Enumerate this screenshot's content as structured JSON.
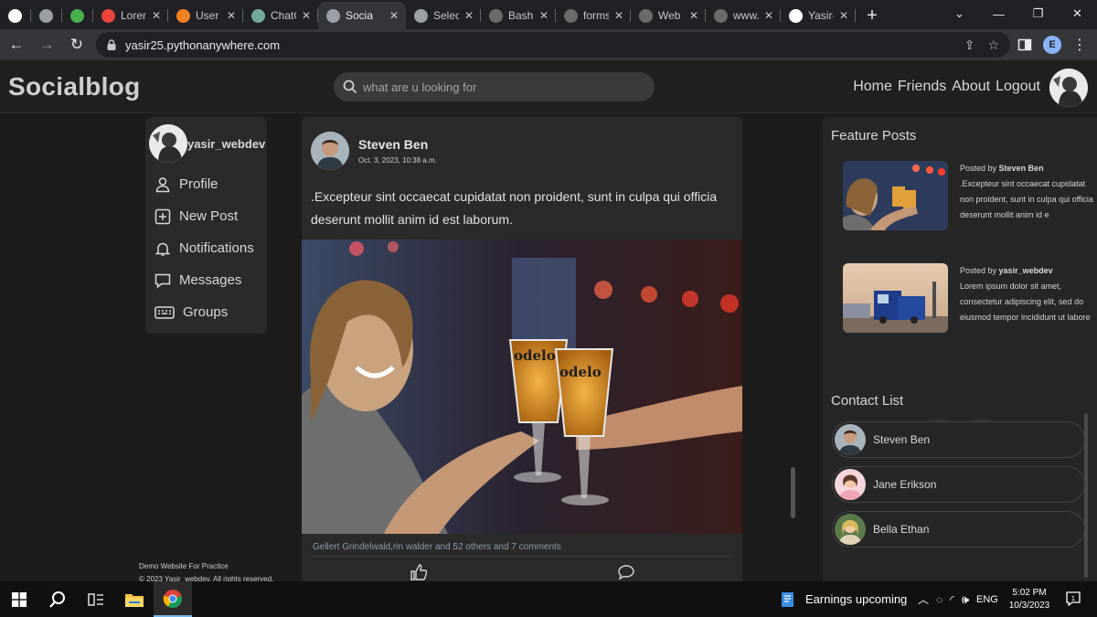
{
  "browser": {
    "tabs": [
      {
        "title": "",
        "favicon": "google-icon",
        "color": "#ffffff"
      },
      {
        "title": "",
        "favicon": "globe-icon",
        "color": "#9aa0a6"
      },
      {
        "title": "",
        "favicon": "colorful-icon",
        "color": "#4caf50"
      },
      {
        "title": "Loren",
        "favicon": "pin-icon",
        "color": "#e8453c"
      },
      {
        "title": "User",
        "favicon": "stack-icon",
        "color": "#f48024"
      },
      {
        "title": "ChatG",
        "favicon": "openai-icon",
        "color": "#74aa9c"
      },
      {
        "title": "Socia",
        "favicon": "globe-icon",
        "color": "#9aa0a6",
        "active": true
      },
      {
        "title": "Selec",
        "favicon": "globe-icon",
        "color": "#9aa0a6"
      },
      {
        "title": "Bash",
        "favicon": "python-icon",
        "color": "#6b6b6b"
      },
      {
        "title": "forms",
        "favicon": "python-icon",
        "color": "#6b6b6b"
      },
      {
        "title": "Web",
        "favicon": "python-icon",
        "color": "#6b6b6b"
      },
      {
        "title": "www.",
        "favicon": "python-icon",
        "color": "#6b6b6b"
      },
      {
        "title": "Yasir-",
        "favicon": "github-icon",
        "color": "#ffffff"
      }
    ],
    "url": "yasir25.pythonanywhere.com",
    "profile_initial": "E"
  },
  "site": {
    "brand": "Socialblog",
    "search_placeholder": "what are u looking for",
    "nav": [
      "Home",
      "Friends",
      "About",
      "Logout"
    ]
  },
  "sidebar": {
    "username": "yasir_webdev",
    "items": [
      {
        "label": "Profile",
        "icon": "user-icon"
      },
      {
        "label": "New Post",
        "icon": "plus-square-icon"
      },
      {
        "label": "Notifications",
        "icon": "bell-icon"
      },
      {
        "label": "Messages",
        "icon": "message-icon"
      },
      {
        "label": "Groups",
        "icon": "keyboard-icon"
      }
    ]
  },
  "footer": {
    "line1": "Demo Website For Practice",
    "line2": "© 2023 Yasir_webdev. All rights reserved."
  },
  "post": {
    "author": "Steven Ben",
    "date": "Oct. 3, 2023, 10:38 a.m.",
    "text": ".Excepteur sint occaecat cupidatat non proident, sunt in culpa qui officia deserunt mollit anim id est laborum.",
    "likes_text": "Gellert Grindelwald,rin walder and 52 others and 7 comments"
  },
  "featured": {
    "title": "Feature Posts",
    "posted_by_label": "Posted by",
    "items": [
      {
        "author": "Steven Ben",
        "excerpt": ".Excepteur sint occaecat cupidatat non proident, sunt in culpa qui officia deserunt mollit anim id e"
      },
      {
        "author": "yasir_webdev",
        "excerpt": "Lorem ipsum dolor sit amet, consectetur adipiscing elit, sed do eiusmod tempor incididunt ut labore"
      }
    ]
  },
  "contacts": {
    "title": "Contact List",
    "items": [
      "Steven Ben",
      "Jane Erikson",
      "Bella Ethan"
    ]
  },
  "taskbar": {
    "news": "Earnings upcoming",
    "lang": "ENG",
    "time": "5:02 PM",
    "date": "10/3/2023",
    "notif_count": "1"
  }
}
